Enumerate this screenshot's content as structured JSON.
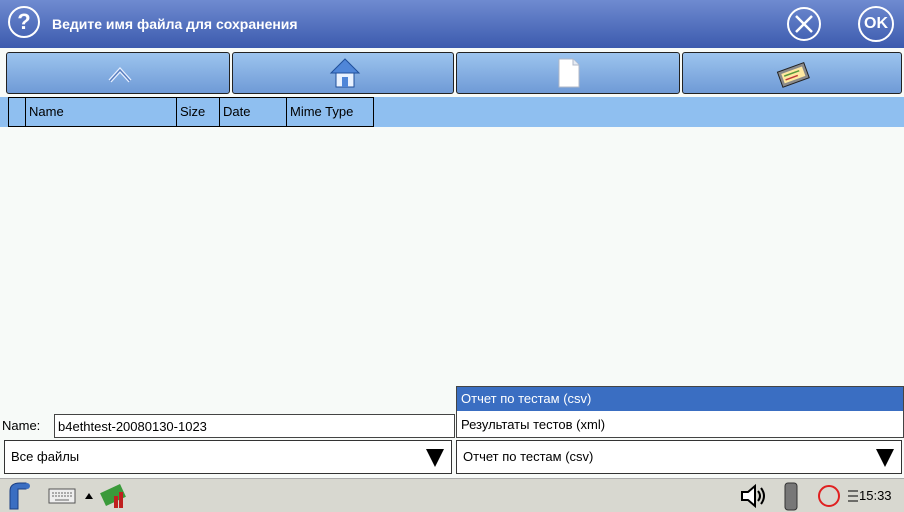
{
  "window": {
    "title": "Ведите имя файла для сохранения",
    "help_label": "?",
    "ok_label": "OK"
  },
  "toolbar": {
    "buttons": [
      "up-folder-icon",
      "home-icon",
      "new-file-icon",
      "folder-view-icon"
    ]
  },
  "columns": [
    "Name",
    "Size",
    "Date",
    "Mime Type"
  ],
  "file_list": [],
  "name_field": {
    "label": "Name:",
    "value": "b4ethtest-20080130-1023"
  },
  "filter_select": {
    "value": "Все файлы"
  },
  "format_select": {
    "value": "Отчет по тестам (csv)",
    "options": [
      "Отчет по тестам (csv)",
      "Результаты тестов (xml)"
    ],
    "highlighted_index": 0
  },
  "taskbar": {
    "clock": "15:33"
  },
  "colors": {
    "title_bar": "#4a67b8",
    "header": "#8fbff0",
    "highlight": "#3a6ec2"
  }
}
